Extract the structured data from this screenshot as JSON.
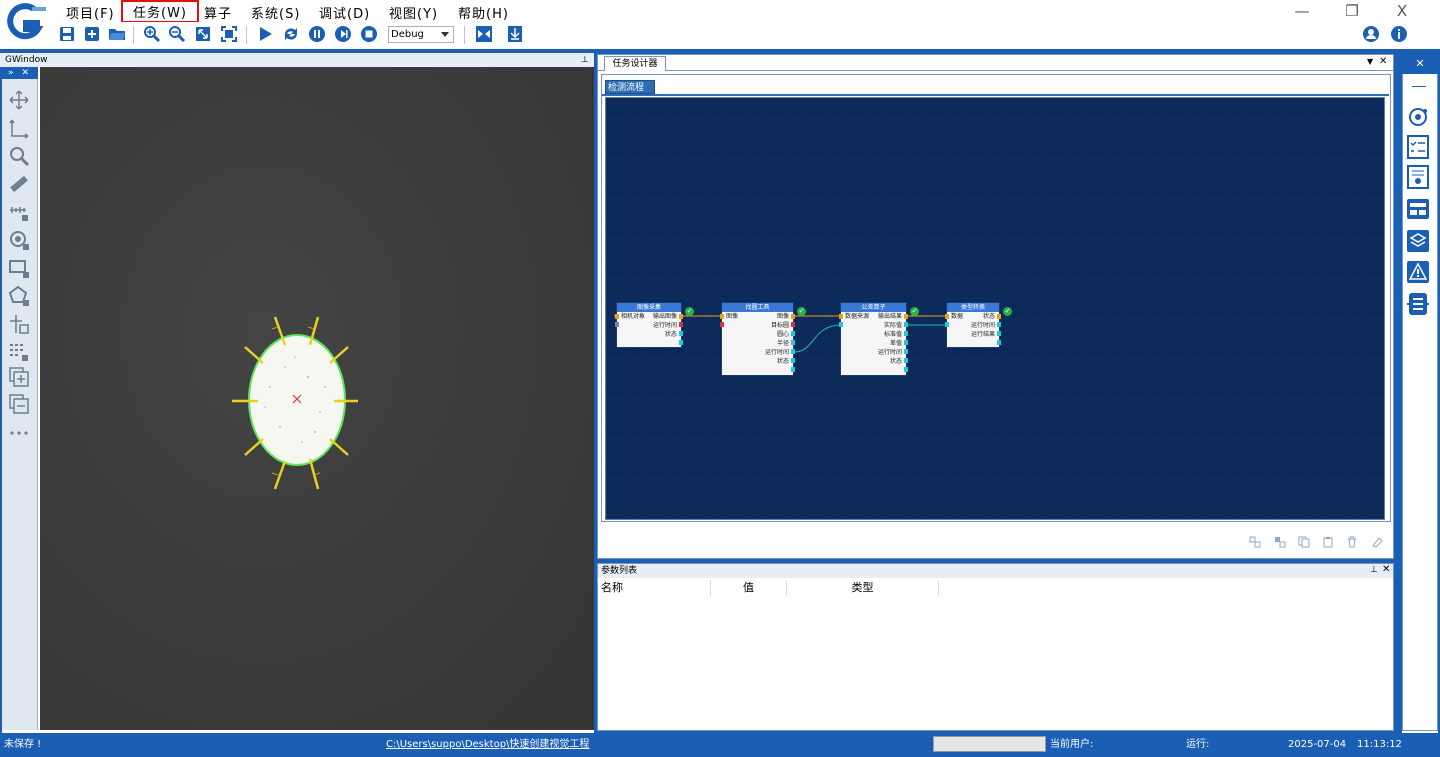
{
  "menu": {
    "items": [
      {
        "label": "项目(F)"
      },
      {
        "label": "任务(W)"
      },
      {
        "label": "算子"
      },
      {
        "label": "系统(S)"
      },
      {
        "label": "调试(D)"
      },
      {
        "label": "视图(Y)"
      },
      {
        "label": "帮助(H)"
      }
    ],
    "window_controls": {
      "minimize": "—",
      "restore": "❐",
      "close": "X"
    }
  },
  "toolbar": {
    "mode_select": "Debug",
    "icons": [
      "save-icon",
      "new-icon",
      "open-folder-icon",
      "zoom-in-icon",
      "zoom-out-icon",
      "fit-icon",
      "fullscreen-icon",
      "run-icon",
      "loop-icon",
      "pause-icon",
      "step-icon",
      "stop-icon",
      "split-icon",
      "download-icon",
      "user-icon",
      "info-icon"
    ]
  },
  "gwindow": {
    "title": "GWindow",
    "pin": "📌",
    "tool_icons": [
      "move-icon",
      "angle-icon",
      "search-icon",
      "ruler-icon",
      "measure-icon",
      "target-icon",
      "rect-select-icon",
      "polygon-icon",
      "grid-plus-icon",
      "grid-select-icon",
      "add-layer-icon",
      "remove-layer-icon",
      "more-icon"
    ]
  },
  "designer": {
    "tab_label": "任务设计器",
    "subtab_label": "检测流程",
    "nodes": [
      {
        "title": "图像采集",
        "rows": [
          {
            "l": "相机对象",
            "r": "输出图像"
          },
          {
            "l": "",
            "r": "运行时间"
          },
          {
            "l": "",
            "r": "状态"
          }
        ]
      },
      {
        "title": "找圆工具",
        "rows": [
          {
            "l": "图像",
            "r": "图像"
          },
          {
            "l": "",
            "r": "目标圆"
          },
          {
            "l": "",
            "r": "圆心"
          },
          {
            "l": "",
            "r": "半径"
          },
          {
            "l": "",
            "r": "运行时间"
          },
          {
            "l": "",
            "r": "状态"
          }
        ]
      },
      {
        "title": "公差算子",
        "rows": [
          {
            "l": "数据来源",
            "r": "输出结果"
          },
          {
            "l": "",
            "r": "实际值"
          },
          {
            "l": "",
            "r": "标准值"
          },
          {
            "l": "",
            "r": "差值"
          },
          {
            "l": "",
            "r": "运行时间"
          },
          {
            "l": "",
            "r": "状态"
          }
        ]
      },
      {
        "title": "类型转换",
        "rows": [
          {
            "l": "数据",
            "r": "状态"
          },
          {
            "l": "",
            "r": "运行时间"
          },
          {
            "l": "",
            "r": "运行结果"
          }
        ]
      }
    ]
  },
  "params": {
    "title": "参数列表",
    "columns": [
      "名称",
      "值",
      "类型"
    ]
  },
  "status": {
    "save_state": "未保存 !",
    "path": "C:\\Users\\suppo\\Desktop\\快速创建视觉工程",
    "current_user": "当前用户:",
    "run": "运行:",
    "date": "2025-07-04",
    "time": "11:13:12"
  },
  "colors": {
    "accent": "#1a5fb4",
    "flow_bg": "#0b2a5a",
    "node_header": "#3a78d6",
    "ok": "#2ab04a"
  }
}
